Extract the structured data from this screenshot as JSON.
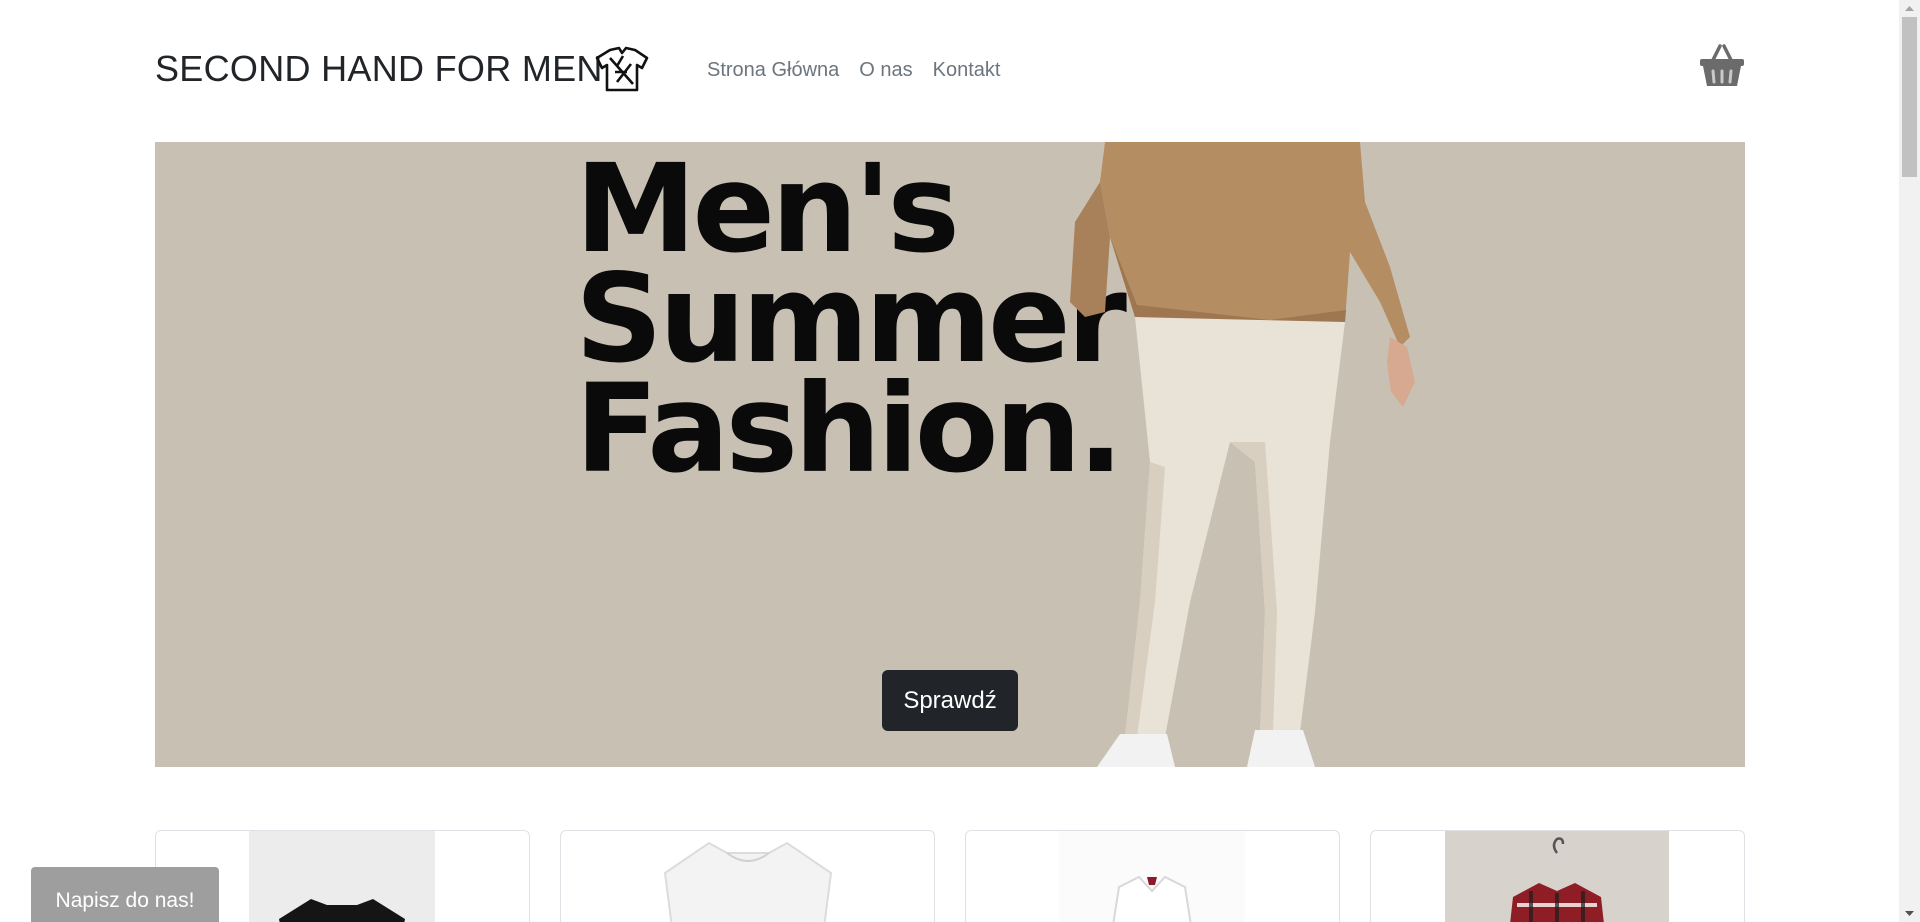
{
  "header": {
    "brand": "SECOND HAND FOR MEN",
    "logo_icon": "shirt-logo-icon",
    "nav": [
      {
        "label": "Strona Główna"
      },
      {
        "label": "O nas"
      },
      {
        "label": "Kontakt"
      }
    ],
    "cart_icon": "basket-icon"
  },
  "hero": {
    "title": "Men's\nSummer\nFashion.",
    "cta_label": "Sprawdź",
    "background": "#c9c0b4"
  },
  "products": [
    {
      "image": "black t-shirt"
    },
    {
      "image": "white t-shirt"
    },
    {
      "image": "white dress shirt"
    },
    {
      "image": "red plaid shirt on hanger"
    }
  ],
  "contact_button": "Napisz do nas!",
  "colors": {
    "text": "#212529",
    "nav": "#6c757d",
    "button_dark": "#212529",
    "contact_bg": "#9e9e9e"
  }
}
